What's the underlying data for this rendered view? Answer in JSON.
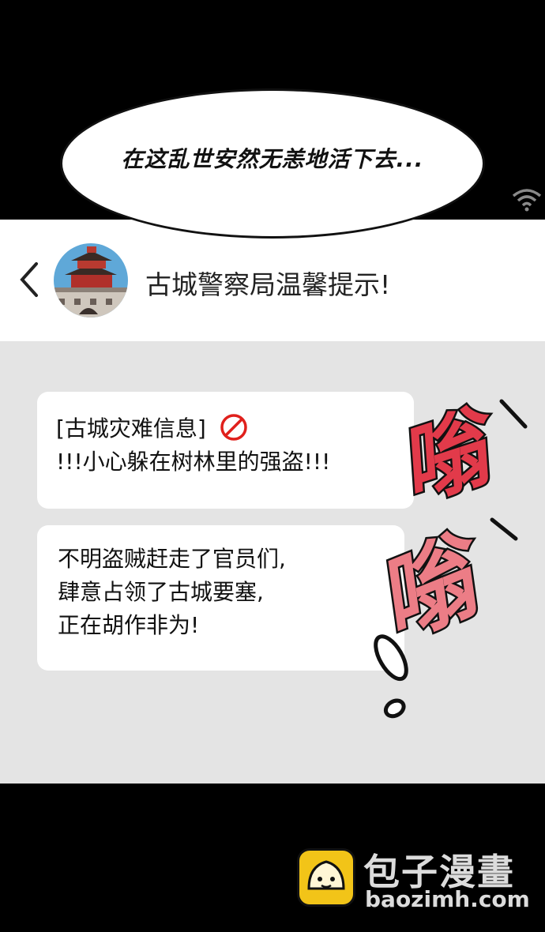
{
  "speech_bubble": {
    "text": "在这乱世安然无恙地活下去..."
  },
  "header": {
    "title": "古城警察局温馨提示!"
  },
  "messages": [
    {
      "lines": [
        "[古城灾难信息]",
        "!!!小心躲在树林里的强盗!!!"
      ]
    },
    {
      "lines": [
        "不明盗贼赶走了官员们,",
        "肆意占领了古城要塞,",
        "正在胡作非为!"
      ]
    }
  ],
  "sound_effect": {
    "text": "嗡嗡!"
  },
  "watermark": {
    "name": "包子漫畫",
    "url": "baozimh.com"
  },
  "icons": [
    "back-icon",
    "avatar-castle-icon",
    "no-entry-icon",
    "wifi-icon",
    "baozi-logo-icon"
  ],
  "colors": {
    "sfx_red": "#e23a4a",
    "no_icon_red": "#e0201c",
    "chat_bg": "#e4e4e4"
  }
}
